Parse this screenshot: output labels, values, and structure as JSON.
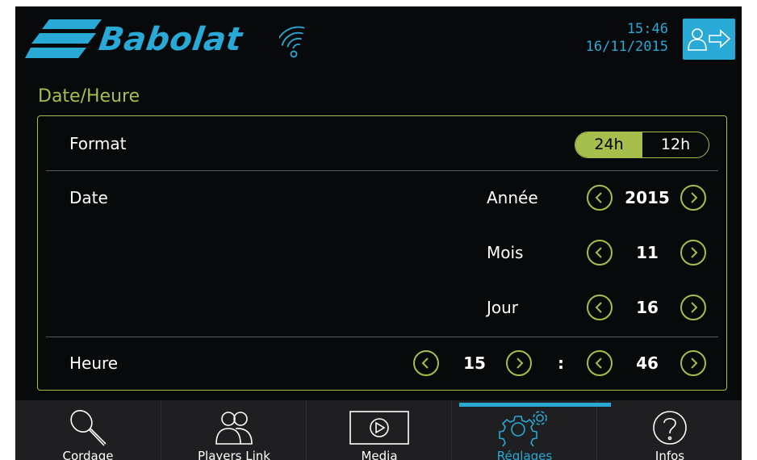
{
  "colors": {
    "accent_blue": "#29a9d5",
    "accent_green": "#a6be4b",
    "background": "#07090b",
    "nav_background": "#1f1f21"
  },
  "header": {
    "brand": "Babolat",
    "time": "15:46",
    "date": "16/11/2015",
    "wifi_icon": "wifi-icon",
    "logout_icon": "user-exit-icon"
  },
  "page": {
    "title": "Date/Heure"
  },
  "format": {
    "label": "Format",
    "options": [
      "24h",
      "12h"
    ],
    "selected": "24h"
  },
  "date": {
    "label": "Date",
    "year_label": "Année",
    "year": "2015",
    "month_label": "Mois",
    "month": "11",
    "day_label": "Jour",
    "day": "16"
  },
  "time": {
    "label": "Heure",
    "hour": "15",
    "separator": ":",
    "minute": "46"
  },
  "nav": {
    "items": [
      {
        "label": "Cordage",
        "icon": "racket-icon"
      },
      {
        "label": "Players Link",
        "icon": "players-icon"
      },
      {
        "label": "Media",
        "icon": "play-icon"
      },
      {
        "label": "Réglages",
        "icon": "gears-icon",
        "active": true
      },
      {
        "label": "Infos",
        "icon": "help-icon"
      }
    ]
  }
}
